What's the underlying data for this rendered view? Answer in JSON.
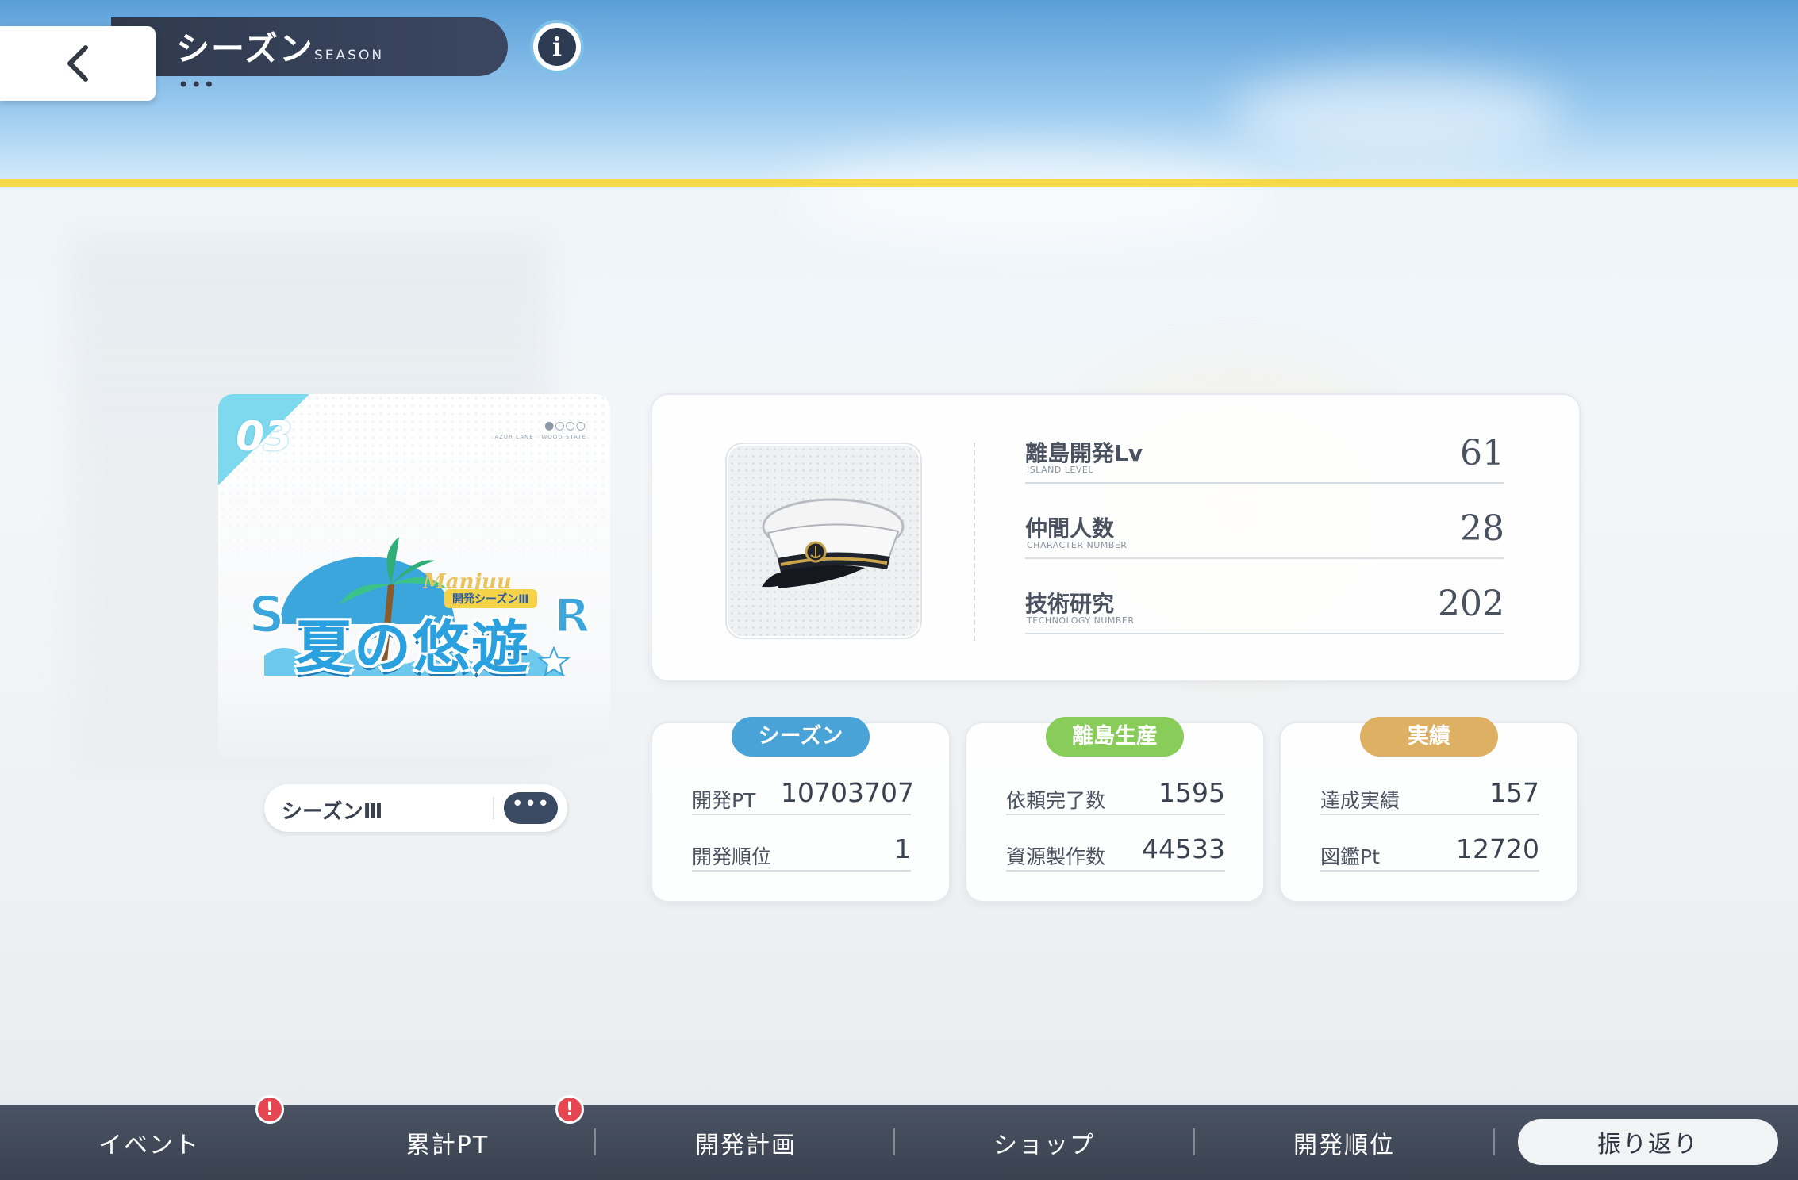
{
  "header": {
    "title": "シーズン",
    "subtitle": "SEASON",
    "dots": "•••",
    "back_symbol": "‹",
    "info_symbol": "i"
  },
  "season_card": {
    "number": "03",
    "brand_dots": "●○○○",
    "brand_text": "AZUR LANE · WOOD STATE",
    "logo_script": "Manjuu",
    "logo_tag": "開発シーズンⅢ",
    "logo_main": "夏の悠遊",
    "logo_colors": {
      "main": "#2aa0de",
      "accent": "#f5d24a",
      "corner": "#7fd9ee"
    }
  },
  "season_select": {
    "label": "シーズンⅢ",
    "button": "•••"
  },
  "stats": [
    {
      "label": "離島開発Lv",
      "sub": "ISLAND LEVEL",
      "value": "61"
    },
    {
      "label": "仲間人数",
      "sub": "CHARACTER NUMBER",
      "value": "28"
    },
    {
      "label": "技術研究",
      "sub": "TECHNOLOGY NUMBER",
      "value": "202"
    }
  ],
  "cards": [
    {
      "badge": "シーズン",
      "color": "#4aa3d6",
      "rows": [
        {
          "label": "開発PT",
          "value": "10703707"
        },
        {
          "label": "開発順位",
          "value": "1"
        }
      ]
    },
    {
      "badge": "離島生産",
      "color": "#88cc5a",
      "rows": [
        {
          "label": "依頼完了数",
          "value": "1595"
        },
        {
          "label": "資源製作数",
          "value": "44533"
        }
      ]
    },
    {
      "badge": "実績",
      "color": "#ddb064",
      "rows": [
        {
          "label": "達成実績",
          "value": "157"
        },
        {
          "label": "図鑑Pt",
          "value": "12720"
        }
      ]
    }
  ],
  "nav": {
    "items": [
      {
        "label": "イベント",
        "alert": "!"
      },
      {
        "label": "累計PT",
        "alert": "!"
      },
      {
        "label": "開発計画"
      },
      {
        "label": "ショップ"
      },
      {
        "label": "開発順位"
      }
    ],
    "active": "振り返り"
  }
}
